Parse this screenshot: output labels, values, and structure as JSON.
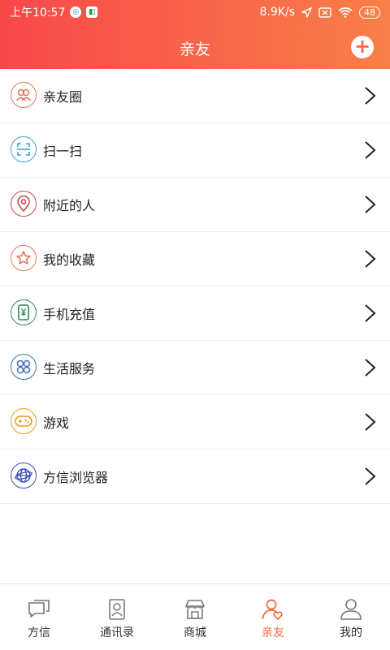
{
  "status_bar": {
    "time": "上午10:57",
    "speed": "8.9K/s",
    "battery": "48",
    "app1": "◎",
    "app2": "◧"
  },
  "header": {
    "title": "亲友",
    "add_icon": "plus-icon"
  },
  "menu": [
    {
      "label": "亲友圈",
      "icon": "friends-circle-icon",
      "color": "#e8745a"
    },
    {
      "label": "扫一扫",
      "icon": "scan-icon",
      "color": "#3aa5c9"
    },
    {
      "label": "附近的人",
      "icon": "location-pin-icon",
      "color": "#c94a4a"
    },
    {
      "label": "我的收藏",
      "icon": "star-icon",
      "color": "#e8745a"
    },
    {
      "label": "手机充值",
      "icon": "phone-recharge-icon",
      "color": "#2e8a55"
    },
    {
      "label": "生活服务",
      "icon": "services-grid-icon",
      "color": "#3f6fb0"
    },
    {
      "label": "游戏",
      "icon": "gamepad-icon",
      "color": "#e79a1e"
    },
    {
      "label": "方信浏览器",
      "icon": "globe-icon",
      "color": "#3f4fb0"
    }
  ],
  "tabs": [
    {
      "label": "方信",
      "icon": "chat-icon"
    },
    {
      "label": "通讯录",
      "icon": "contacts-icon"
    },
    {
      "label": "商城",
      "icon": "shop-icon"
    },
    {
      "label": "亲友",
      "icon": "friends-icon",
      "active": true
    },
    {
      "label": "我的",
      "icon": "profile-icon"
    }
  ],
  "colors": {
    "header_start": "#f8484a",
    "header_end": "#f98048",
    "active_tab": "#f4663c"
  }
}
